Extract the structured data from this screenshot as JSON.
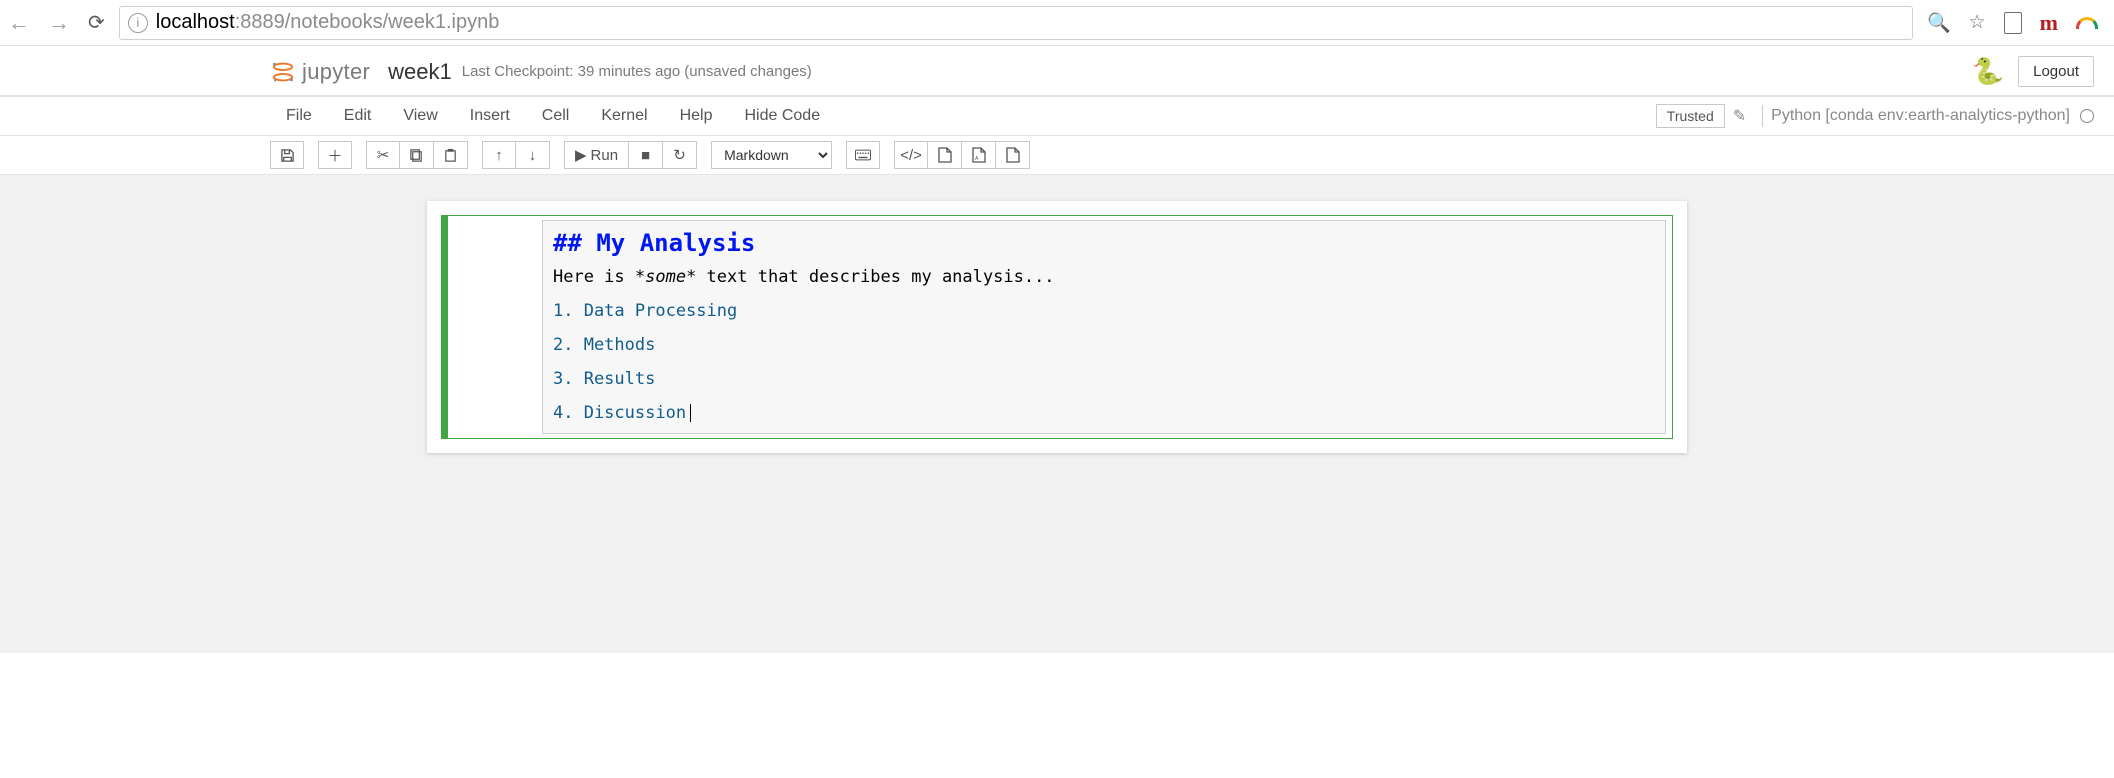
{
  "browser": {
    "url_host": "localhost",
    "url_path": ":8889/notebooks/week1.ipynb"
  },
  "header": {
    "logo_text": "jupyter",
    "notebook_name": "week1",
    "checkpoint": "Last Checkpoint: 39 minutes ago",
    "unsaved": "(unsaved changes)",
    "logout": "Logout"
  },
  "menu": {
    "items": [
      "File",
      "Edit",
      "View",
      "Insert",
      "Cell",
      "Kernel",
      "Help",
      "Hide Code"
    ],
    "trusted": "Trusted",
    "kernel": "Python [conda env:earth-analytics-python]"
  },
  "toolbar": {
    "run_label": "Run",
    "celltype": "Markdown"
  },
  "cell": {
    "heading": "## My Analysis",
    "text_before": "Here is ",
    "text_em": "*some*",
    "text_after": " text that describes my analysis...",
    "list": [
      "1. Data Processing",
      "2. Methods",
      "3. Results",
      "4. Discussion"
    ]
  }
}
